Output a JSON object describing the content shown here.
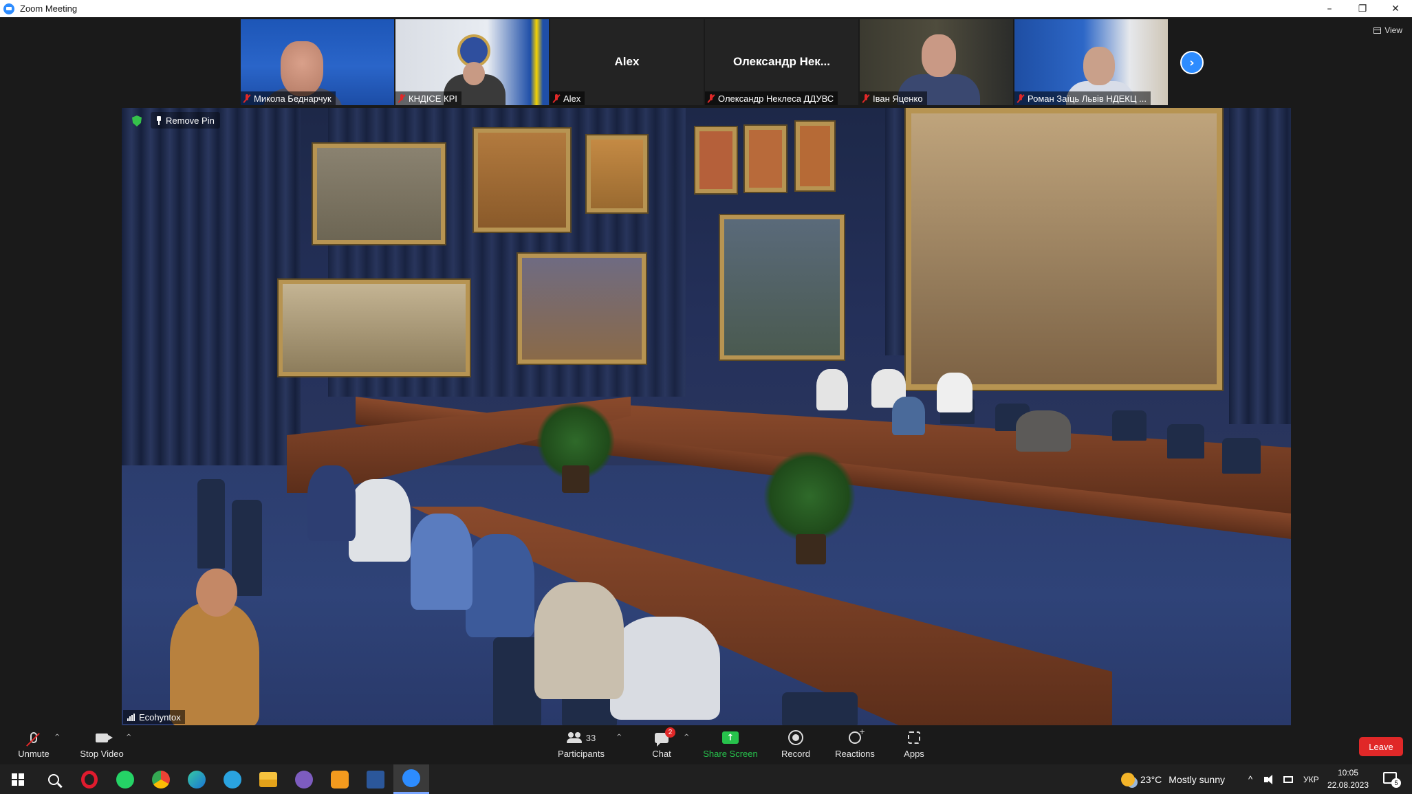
{
  "window": {
    "title": "Zoom Meeting",
    "minimize": "–",
    "restore": "❐",
    "close": "✕"
  },
  "strip": {
    "participants": [
      {
        "label": "Микола Беднарчук",
        "center_name": ""
      },
      {
        "label": "КНДІСЕ КРІ",
        "center_name": ""
      },
      {
        "label": "Alex",
        "center_name": "Alex"
      },
      {
        "label": "Олександр Неклеса ДДУВС",
        "center_name": "Олександр Нек..."
      },
      {
        "label": "Іван Яценко",
        "center_name": ""
      },
      {
        "label": "Роман Заїць Львів НДЕКЦ ...",
        "center_name": ""
      }
    ],
    "next_arrow": "›",
    "view_label": "View"
  },
  "main": {
    "remove_pin_label": "Remove Pin",
    "speaker_name": "Ecohyntox"
  },
  "toolbar": {
    "unmute": "Unmute",
    "stop_video": "Stop Video",
    "participants": "Participants",
    "participants_count": "33",
    "chat": "Chat",
    "chat_badge": "2",
    "share_screen": "Share Screen",
    "share_arrow": "↑",
    "record": "Record",
    "reactions": "Reactions",
    "apps": "Apps",
    "leave": "Leave",
    "caret": "^"
  },
  "taskbar": {
    "apps": [
      "windows-start",
      "search",
      "opera",
      "whatsapp",
      "chrome",
      "edge",
      "telegram",
      "file-explorer",
      "viber",
      "photo-app",
      "word",
      "zoom"
    ],
    "weather_temp": "23°C",
    "weather_desc": "Mostly sunny",
    "tray_arrow": "^",
    "lang": "УКР",
    "time": "10:05",
    "date": "22.08.2023",
    "notification_count": "5"
  },
  "colors": {
    "zoom_blue": "#2d8cff",
    "leave_red": "#e02828",
    "share_green": "#27c24c",
    "toolbar_bg": "#1a1a1a",
    "taskbar_bg": "#202020"
  }
}
